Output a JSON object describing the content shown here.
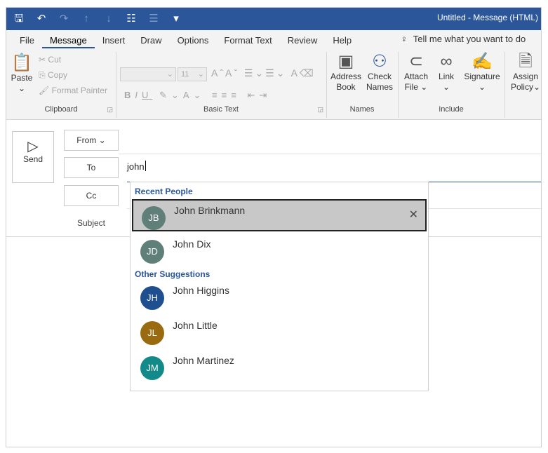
{
  "window": {
    "title": "Untitled - Message (HTML)"
  },
  "menu": {
    "tabs": [
      {
        "label": "File"
      },
      {
        "label": "Message"
      },
      {
        "label": "Insert"
      },
      {
        "label": "Draw"
      },
      {
        "label": "Options"
      },
      {
        "label": "Format Text"
      },
      {
        "label": "Review"
      },
      {
        "label": "Help"
      }
    ],
    "tell_me": "Tell me what you want to do"
  },
  "ribbon": {
    "clipboard": {
      "label": "Clipboard",
      "paste": "Paste",
      "cut": "Cut",
      "copy": "Copy",
      "format_painter": "Format Painter"
    },
    "basic_text": {
      "label": "Basic Text",
      "font_size": "11"
    },
    "names": {
      "label": "Names",
      "address_book_1": "Address",
      "address_book_2": "Book",
      "check_names_1": "Check",
      "check_names_2": "Names"
    },
    "include": {
      "label": "Include",
      "attach_1": "Attach",
      "attach_2": "File",
      "link": "Link",
      "signature": "Signature"
    },
    "policy": {
      "assign_1": "Assign",
      "assign_2": "Policy"
    }
  },
  "compose": {
    "send": "Send",
    "from": "From",
    "to": "To",
    "cc": "Cc",
    "subject": "Subject",
    "to_value": "john"
  },
  "suggestions": {
    "recent_title": "Recent People",
    "other_title": "Other Suggestions",
    "recent": [
      {
        "initials": "JB",
        "name": "John Brinkmann",
        "color": "#5f7f78"
      },
      {
        "initials": "JD",
        "name": "John Dix",
        "color": "#5f7f78"
      }
    ],
    "other": [
      {
        "initials": "JH",
        "name": "John Higgins",
        "color": "#1f4f8f"
      },
      {
        "initials": "JL",
        "name": "John Little",
        "color": "#9a6a10"
      },
      {
        "initials": "JM",
        "name": "John Martinez",
        "color": "#138a8a"
      }
    ]
  },
  "colors": {
    "accent": "#2b579a"
  }
}
